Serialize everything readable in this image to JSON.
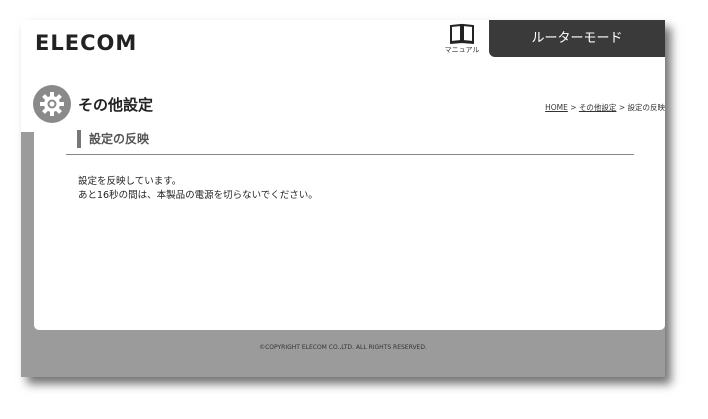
{
  "header": {
    "logo": "ELECOM",
    "manual_label": "マニュアル",
    "mode": "ルーターモード"
  },
  "page": {
    "title": "その他設定",
    "section_title": "設定の反映",
    "message_line1": "設定を反映しています。",
    "message_line2": "あと16秒の間は、本製品の電源を切らないでください。"
  },
  "breadcrumb": {
    "home": "HOME",
    "sep1": " > ",
    "other_settings": "その他設定",
    "sep2": " > ",
    "current": "設定の反映"
  },
  "footer": {
    "copyright": "©COPYRIGHT ELECOM CO.,LTD. ALL RIGHTS RESERVED."
  },
  "icons": {
    "manual": "book-icon",
    "settings": "gear-icon"
  },
  "colors": {
    "mode_badge_bg": "#3a3a3a",
    "frame_bg": "#9b9b9b",
    "title_icon_bg": "#8a8a8a"
  }
}
